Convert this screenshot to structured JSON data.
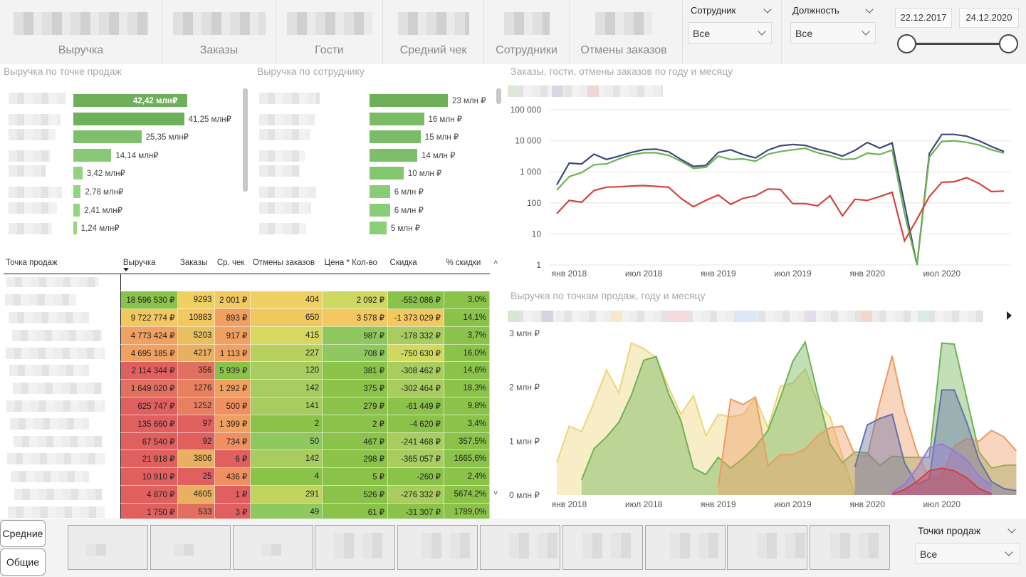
{
  "kpis": [
    {
      "label": "Выручка"
    },
    {
      "label": "Заказы"
    },
    {
      "label": "Гости"
    },
    {
      "label": "Средний чек"
    },
    {
      "label": "Сотрудники"
    },
    {
      "label": "Отмены заказов"
    }
  ],
  "filters": {
    "employee": {
      "title": "Сотрудник",
      "value": "Все"
    },
    "position": {
      "title": "Должность",
      "value": "Все"
    },
    "date_from": "22.12.2017",
    "date_to": "24.12.2020",
    "points": {
      "title": "Точки продаж",
      "value": "Все"
    }
  },
  "revenue_by_point": {
    "title": "Выручка по точке продаж",
    "bars": [
      {
        "label": "42,42 млн₽",
        "value": 42.42
      },
      {
        "label": "41,25 млн₽",
        "value": 41.25
      },
      {
        "label": "25,35 млн₽",
        "value": 25.35
      },
      {
        "label": "14,14 млн₽",
        "value": 14.14
      },
      {
        "label": "3,42 млн₽",
        "value": 3.42
      },
      {
        "label": "2,78 млн₽",
        "value": 2.78
      },
      {
        "label": "2,41 млн₽",
        "value": 2.41
      },
      {
        "label": "1,24 млн₽",
        "value": 1.24
      }
    ]
  },
  "revenue_by_employee": {
    "title": "Выручка по сотруднику",
    "bars": [
      {
        "label": "23 млн ₽",
        "value": 23
      },
      {
        "label": "16 млн ₽",
        "value": 16
      },
      {
        "label": "15 млн ₽",
        "value": 15
      },
      {
        "label": "14 млн ₽",
        "value": 14
      },
      {
        "label": "10 млн ₽",
        "value": 10
      },
      {
        "label": "6 млн ₽",
        "value": 6
      },
      {
        "label": "6 млн ₽",
        "value": 6
      },
      {
        "label": "5 млн ₽",
        "value": 5
      }
    ]
  },
  "table": {
    "headers": [
      "Точка продаж",
      "Выручка",
      "Заказы",
      "Ср. чек",
      "Отмены заказов",
      "Цена * Кол-во",
      "Скидка",
      "% скидки"
    ],
    "rows": [
      [
        "18 596 530 ₽",
        "9293",
        "2 001 ₽",
        "404",
        "2 092 ₽",
        "-552 086 ₽",
        "3,0%"
      ],
      [
        "9 722 774 ₽",
        "10883",
        "893 ₽",
        "650",
        "3 578 ₽",
        "-1 373 029 ₽",
        "14,1%"
      ],
      [
        "4 773 424 ₽",
        "5203",
        "917 ₽",
        "415",
        "987 ₽",
        "-178 332 ₽",
        "3,7%"
      ],
      [
        "4 695 185 ₽",
        "4217",
        "1 113 ₽",
        "227",
        "708 ₽",
        "-750 630 ₽",
        "16,0%"
      ],
      [
        "2 114 344 ₽",
        "356",
        "5 939 ₽",
        "120",
        "381 ₽",
        "-308 462 ₽",
        "14,6%"
      ],
      [
        "1 649 020 ₽",
        "1276",
        "1 292 ₽",
        "142",
        "375 ₽",
        "-302 464 ₽",
        "18,3%"
      ],
      [
        "625 747 ₽",
        "1252",
        "500 ₽",
        "141",
        "279 ₽",
        "-61 449 ₽",
        "9,8%"
      ],
      [
        "135 660 ₽",
        "97",
        "1 399 ₽",
        "2",
        "2 ₽",
        "-4 620 ₽",
        "3,4%"
      ],
      [
        "67 540 ₽",
        "92",
        "734 ₽",
        "50",
        "467 ₽",
        "-241 468 ₽",
        "357,5%"
      ],
      [
        "21 918 ₽",
        "3806",
        "6 ₽",
        "142",
        "298 ₽",
        "-365 057 ₽",
        "1665,6%"
      ],
      [
        "10 910 ₽",
        "25",
        "436 ₽",
        "4",
        "5 ₽",
        "-260 ₽",
        "2,4%"
      ],
      [
        "4 870 ₽",
        "4605",
        "1 ₽",
        "291",
        "526 ₽",
        "-276 332 ₽",
        "5674,2%"
      ],
      [
        "1 750 ₽",
        "533",
        "3 ₽",
        "49",
        "61 ₽",
        "-31 307 ₽",
        "1789,0%"
      ]
    ],
    "colors": [
      [
        "#8bc34a",
        "#f0d060",
        "#f3c860",
        "#f0d060",
        "#cfd860",
        "#8bc34a",
        "#8bc34a"
      ],
      [
        "#f3c860",
        "#f3c860",
        "#f0a060",
        "#f0c860",
        "#f3c860",
        "#f3c860",
        "#8bc34a"
      ],
      [
        "#f0a060",
        "#e8c060",
        "#f0a060",
        "#d8d860",
        "#90c860",
        "#a8cc60",
        "#8bc34a"
      ],
      [
        "#f0a060",
        "#e8b060",
        "#f0a060",
        "#b8d060",
        "#90c860",
        "#d0d860",
        "#8bc34a"
      ],
      [
        "#e06060",
        "#e07060",
        "#8bc34a",
        "#a8cc60",
        "#8bc34a",
        "#a8cc60",
        "#8bc34a"
      ],
      [
        "#e07060",
        "#e88060",
        "#f0a060",
        "#a8cc60",
        "#8bc34a",
        "#a8cc60",
        "#8bc34a"
      ],
      [
        "#e06060",
        "#e88060",
        "#f09060",
        "#a8cc60",
        "#8bc34a",
        "#8bc34a",
        "#8bc34a"
      ],
      [
        "#e06060",
        "#e06060",
        "#f0a060",
        "#8bc34a",
        "#8bc34a",
        "#8bc34a",
        "#8bc34a"
      ],
      [
        "#e06060",
        "#e06060",
        "#f09060",
        "#90c860",
        "#8bc34a",
        "#a8cc60",
        "#8bc34a"
      ],
      [
        "#e06060",
        "#e8b060",
        "#e06060",
        "#a8cc60",
        "#8bc34a",
        "#a8cc60",
        "#8bc34a"
      ],
      [
        "#e06060",
        "#e06060",
        "#f09060",
        "#8bc34a",
        "#8bc34a",
        "#8bc34a",
        "#8bc34a"
      ],
      [
        "#e06060",
        "#e8b060",
        "#e06060",
        "#c0d460",
        "#8bc34a",
        "#a8cc60",
        "#8bc34a"
      ],
      [
        "#e06060",
        "#e07060",
        "#e06060",
        "#90c860",
        "#8bc34a",
        "#8bc34a",
        "#8bc34a"
      ]
    ]
  },
  "chart_data": [
    {
      "type": "line",
      "title": "Заказы, гости, отмены заказов по году и месяцу",
      "y_scale": "log",
      "y_ticks": [
        "1",
        "10",
        "100",
        "1 000",
        "10 000",
        "100 000"
      ],
      "x_ticks": [
        "янв 2018",
        "июл 2018",
        "янв 2019",
        "июл 2019",
        "янв 2020",
        "июл 2020"
      ],
      "x": [
        "2017-12",
        "2018-01",
        "2018-02",
        "2018-03",
        "2018-04",
        "2018-05",
        "2018-06",
        "2018-07",
        "2018-08",
        "2018-09",
        "2018-10",
        "2018-11",
        "2018-12",
        "2019-01",
        "2019-02",
        "2019-03",
        "2019-04",
        "2019-05",
        "2019-06",
        "2019-07",
        "2019-08",
        "2019-09",
        "2019-10",
        "2019-11",
        "2019-12",
        "2020-01",
        "2020-02",
        "2020-03",
        "2020-04",
        "2020-05",
        "2020-06",
        "2020-07",
        "2020-08",
        "2020-09",
        "2020-10",
        "2020-11",
        "2020-12"
      ],
      "series": [
        {
          "color": "#3c4a78",
          "values": [
            380,
            1900,
            1800,
            3700,
            2500,
            3200,
            4200,
            5200,
            5400,
            4400,
            2500,
            1500,
            1600,
            4200,
            5100,
            3600,
            2800,
            5000,
            6900,
            7600,
            7100,
            5300,
            4300,
            3200,
            4900,
            8800,
            5800,
            8500,
            90,
            1,
            3900,
            16000,
            16000,
            14000,
            10000,
            6500,
            4500
          ]
        },
        {
          "color": "#6db356",
          "values": [
            260,
            700,
            950,
            1700,
            1800,
            2600,
            3500,
            4100,
            4100,
            3400,
            2200,
            1300,
            1400,
            3200,
            2500,
            2600,
            2200,
            3700,
            4500,
            5100,
            5700,
            4100,
            3300,
            2500,
            2600,
            4000,
            3600,
            5000,
            45,
            1,
            3000,
            9500,
            10000,
            8900,
            7300,
            5100,
            4000
          ]
        },
        {
          "color": "#d0453c",
          "values": [
            45,
            120,
            105,
            250,
            320,
            330,
            350,
            360,
            340,
            320,
            140,
            75,
            120,
            180,
            90,
            140,
            170,
            280,
            270,
            95,
            95,
            80,
            170,
            38,
            130,
            120,
            160,
            220,
            6,
            30,
            160,
            460,
            480,
            650,
            420,
            230,
            240
          ]
        }
      ]
    },
    {
      "type": "area",
      "title": "Выручка по точкам продаж, году и месяцу",
      "y_ticks": [
        "0 млн ₽",
        "1 млн ₽",
        "2 млн ₽",
        "3 млн ₽"
      ],
      "x_ticks": [
        "янв 2018",
        "июл 2018",
        "янв 2019",
        "июл 2019",
        "янв 2020",
        "июл 2020"
      ],
      "ylim": [
        0,
        3
      ],
      "series": [
        {
          "color": "#ecd57a",
          "start": 0,
          "values": [
            0.6,
            1.28,
            1.18,
            1.72,
            2.32,
            1.9,
            2.82,
            2.72,
            2.55,
            2.0,
            1.5,
            1.85,
            1.1,
            1.5,
            1.45,
            1.5,
            1.8,
            1.25,
            2.02,
            2.08,
            2.34,
            1.72,
            1.45,
            0.72,
            0.0
          ]
        },
        {
          "color": "#6db356",
          "start": 2,
          "values": [
            0.28,
            0.86,
            1.08,
            1.35,
            1.85,
            2.5,
            2.57,
            1.88,
            1.38,
            0.5,
            0.38,
            0.7,
            0.5,
            0.68,
            0.9,
            1.2,
            1.8,
            2.48,
            2.84,
            1.88,
            0.95,
            0.6,
            0.8,
            0.78,
            0.55,
            0.72,
            0.7,
            0.7,
            0.7,
            2.82,
            2.8,
            1.8,
            0.8,
            0.5,
            0.55,
            0.56
          ]
        },
        {
          "color": "#ee9a63",
          "start": 13,
          "values": [
            0.15,
            1.78,
            1.68,
            1.82,
            0.55,
            0.75,
            0.75,
            0.85,
            1.1,
            1.25,
            1.28,
            0.75,
            0.72,
            1.72,
            2.58,
            1.55,
            0.8,
            0.3,
            0.35,
            0.9,
            1.05,
            1.0,
            1.2,
            1.08,
            0.82
          ]
        },
        {
          "color": "#6671a8",
          "start": 24,
          "values": [
            0.52,
            1.3,
            1.42,
            1.5,
            0.6,
            0.2,
            0.3,
            1.95,
            1.95,
            1.35,
            0.65,
            0.25,
            0.12,
            0.08
          ]
        },
        {
          "color": "#9a78d8",
          "start": 27,
          "values": [
            0.05,
            0.2,
            0.5,
            0.88,
            0.95,
            0.82,
            0.65,
            0.35,
            0.18
          ]
        },
        {
          "color": "#d04040",
          "start": 27,
          "values": [
            0.02,
            0.1,
            0.25,
            0.45,
            0.5,
            0.45,
            0.32,
            0.12,
            0.02
          ]
        }
      ]
    }
  ],
  "buttons": {
    "averages": "Средние",
    "totals": "Общие"
  }
}
